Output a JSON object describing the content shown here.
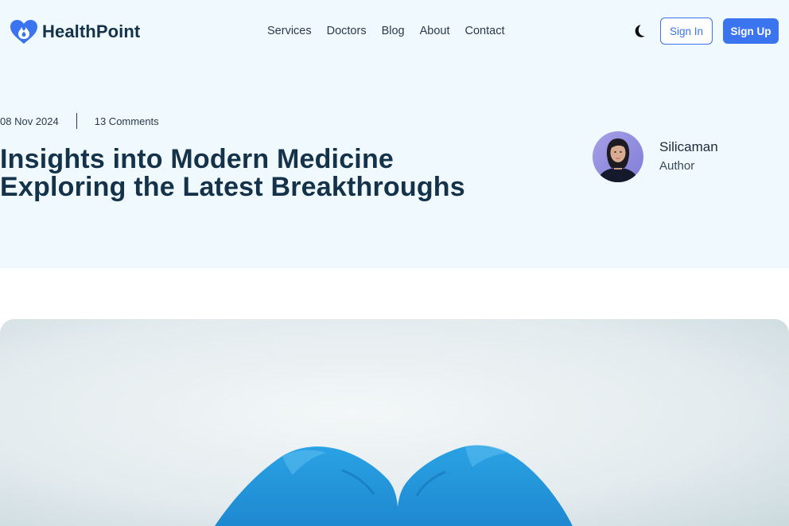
{
  "brand": {
    "name": "HealthPoint",
    "icon": "heart-logo-icon",
    "color": "#3a74ee"
  },
  "nav": {
    "items": [
      {
        "label": "Services"
      },
      {
        "label": "Doctors"
      },
      {
        "label": "Blog"
      },
      {
        "label": "About"
      },
      {
        "label": "Contact"
      }
    ]
  },
  "header": {
    "theme_toggle_icon": "moon-icon",
    "signin_label": "Sign In",
    "signup_label": "Sign Up"
  },
  "article": {
    "date": "08 Nov 2024",
    "comments": "13 Comments",
    "title_line1": "Insights into Modern Medicine",
    "title_line2": "Exploring the Latest Breakthroughs",
    "author": {
      "name": "Silicaman",
      "role": "Author"
    },
    "feature_image": "gloved-hands-heart-image"
  },
  "colors": {
    "hero_background": "#eff9fe",
    "accent": "#3a74ee",
    "heading": "#14324a"
  }
}
